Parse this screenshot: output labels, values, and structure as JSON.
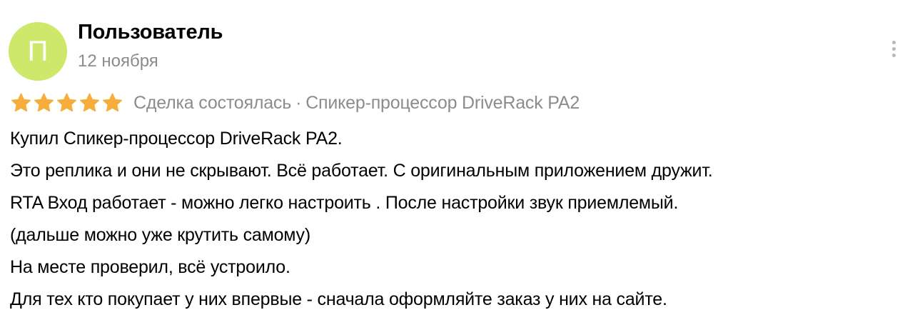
{
  "review": {
    "author_name": "Пользователь",
    "avatar_letter": "П",
    "avatar_color": "#cde86a",
    "date": "12 ноября",
    "more_icon": "more-vertical-icon",
    "rating": 5,
    "rating_max": 5,
    "star_color": "#f6ad3c",
    "deal_status": "Сделка состоялась",
    "separator": "·",
    "product": "Спикер-процессор DriveRack PA2",
    "text_lines": [
      "Купил Спикер-процессор DriveRack PA2.",
      "Это реплика и они не скрывают. Всё работает. С оригинальным приложением дружит.",
      "RTA Вход работает - можно легко настроить . После настройки звук приемлемый.",
      "(дальше можно уже крутить самому)",
      "На месте проверил, всё устроило.",
      "Для тех кто покупает у них впервые - сначала оформляйте заказ у них на сайте."
    ]
  }
}
